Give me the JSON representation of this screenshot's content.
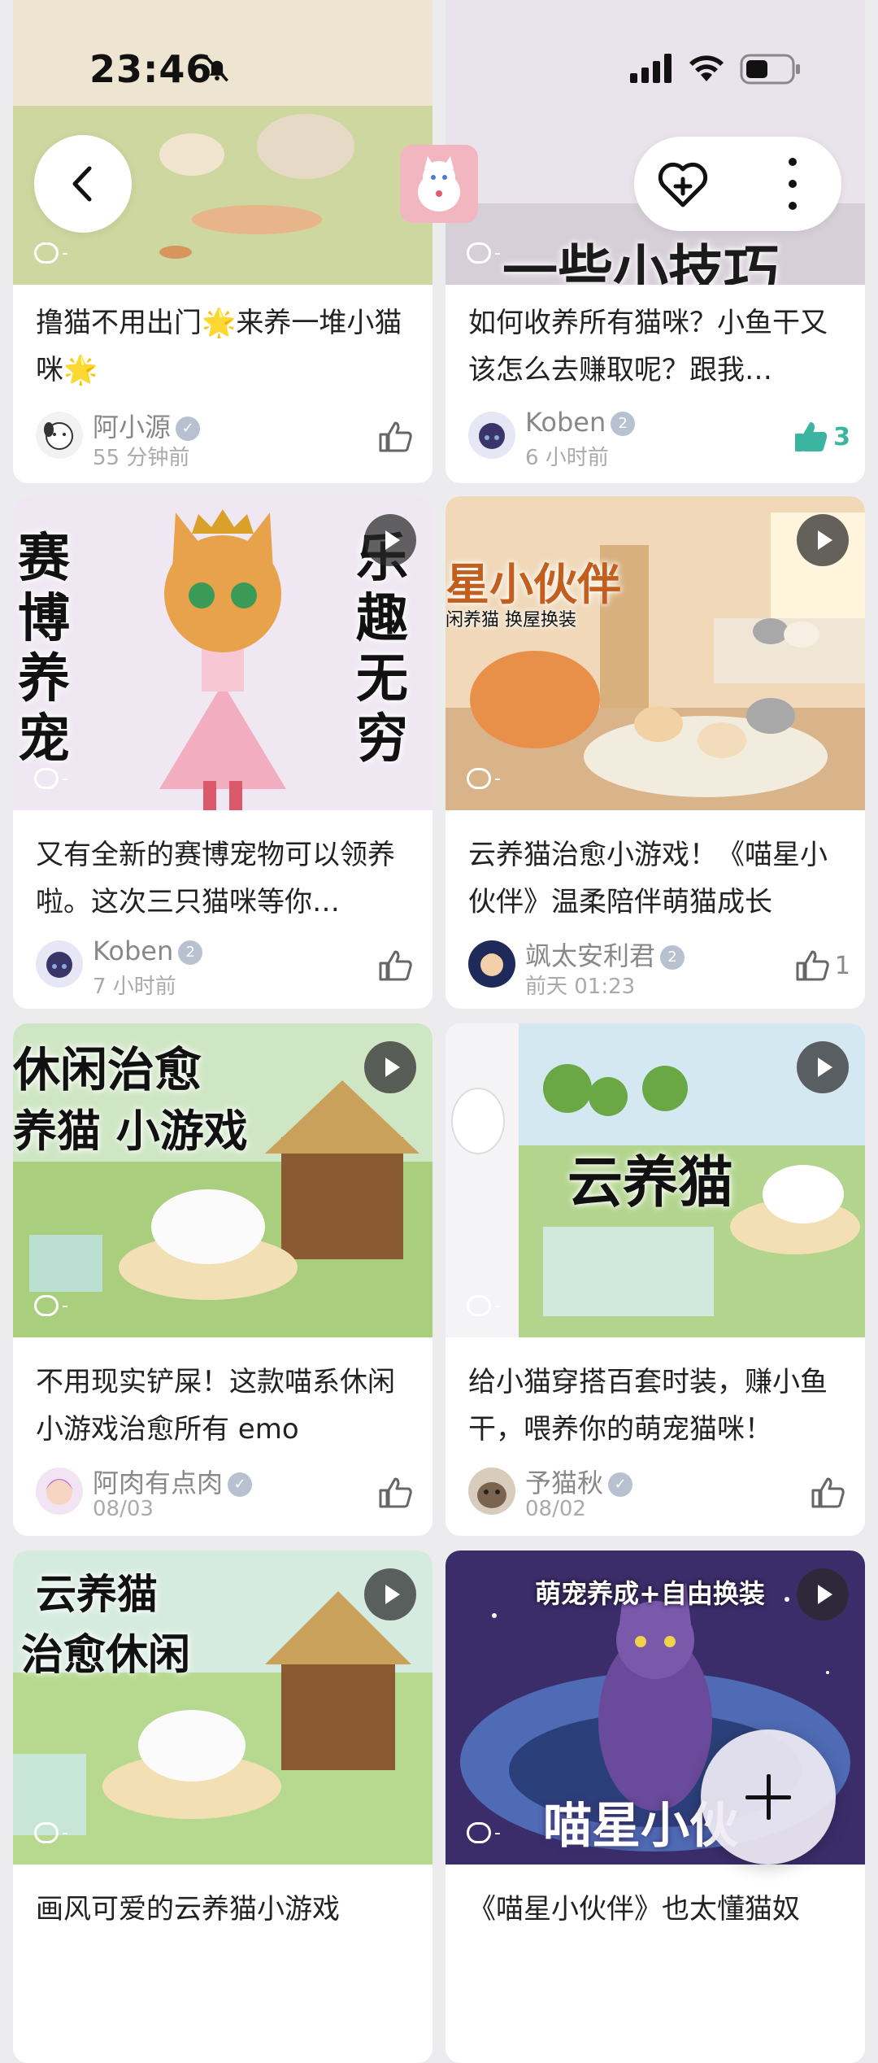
{
  "status_bar": {
    "time": "23:46"
  },
  "header": {
    "back_icon": "chevron-left-icon",
    "favorite_icon": "heart-plus-icon",
    "more_icon": "more-vertical-icon"
  },
  "cards": [
    {
      "title": "撸猫不用出门🌟来养一堆小猫咪🌟",
      "author": "阿小源",
      "time": "55 分钟前",
      "likes": "",
      "liked": false,
      "comments": "-",
      "video": true,
      "overlay": ""
    },
    {
      "title": "如何收养所有猫咪？小鱼干又该怎么去赚取呢？跟我…",
      "author": "Koben",
      "time": "6 小时前",
      "likes": "3",
      "liked": true,
      "comments": "-",
      "video": true,
      "overlay": "一些小技巧"
    },
    {
      "title": "又有全新的赛博宠物可以领养啦。这次三只猫咪等你…",
      "author": "Koben",
      "time": "7 小时前",
      "likes": "",
      "liked": false,
      "comments": "-",
      "video": true,
      "overlay_left": "赛博养宠",
      "overlay_right": "乐趣无穷"
    },
    {
      "title": "云养猫治愈小游戏！《喵星小伙伴》温柔陪伴萌猫成长",
      "author": "飒太安利君",
      "time": "前天 01:23",
      "likes": "1",
      "liked": false,
      "comments": "-",
      "video": true,
      "overlay": "星小伙伴",
      "overlay_sub": "闲养猫 换屋换装"
    },
    {
      "title": "不用现实铲屎！这款喵系休闲小游戏治愈所有 emo",
      "author": "阿肉有点肉",
      "time": "08/03",
      "likes": "",
      "liked": false,
      "comments": "-",
      "video": true,
      "overlay": "休闲治愈",
      "overlay_sub": "养猫 小游戏"
    },
    {
      "title": "给小猫穿搭百套时装，赚小鱼干，喂养你的萌宠猫咪！",
      "author": "予猫秋",
      "time": "08/02",
      "likes": "",
      "liked": false,
      "comments": "-",
      "video": true,
      "overlay": "云养猫"
    },
    {
      "title": "画风可爱的云养猫小游戏",
      "author": "",
      "time": "",
      "likes": "",
      "liked": false,
      "comments": "-",
      "video": true,
      "overlay": "云养猫",
      "overlay_sub": "治愈休闲"
    },
    {
      "title": "《喵星小伙伴》也太懂猫奴",
      "author": "",
      "time": "",
      "likes": "",
      "liked": false,
      "comments": "-",
      "video": true,
      "overlay": "萌宠养成+自由换装",
      "overlay_sub": "喵星小伙"
    }
  ]
}
